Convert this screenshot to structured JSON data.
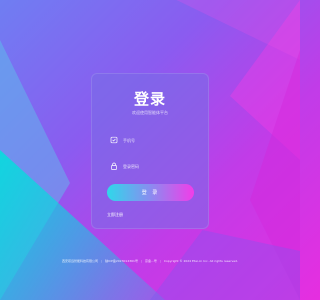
{
  "login": {
    "title": "登录",
    "subtitle": "欢迎使用智能体平台",
    "username_placeholder": "手机号",
    "password_placeholder": "登录密码",
    "submit_label": "登 录",
    "register_link": "立即注册"
  },
  "footer": {
    "company": "西安驭远智能科技有限公司",
    "icp": "陕ICP备2023014361号",
    "police": "京备...号",
    "copyright": "Copyright © 2024 Etai.cn Inc. All rights reserved."
  },
  "icons": {
    "phone": "phone-icon",
    "lock": "lock-icon"
  },
  "colors": {
    "button_gradient_start": "#2fd8ea",
    "button_gradient_end": "#f13de8",
    "background_start": "#6f7ef2",
    "background_end": "#e62ee0"
  }
}
